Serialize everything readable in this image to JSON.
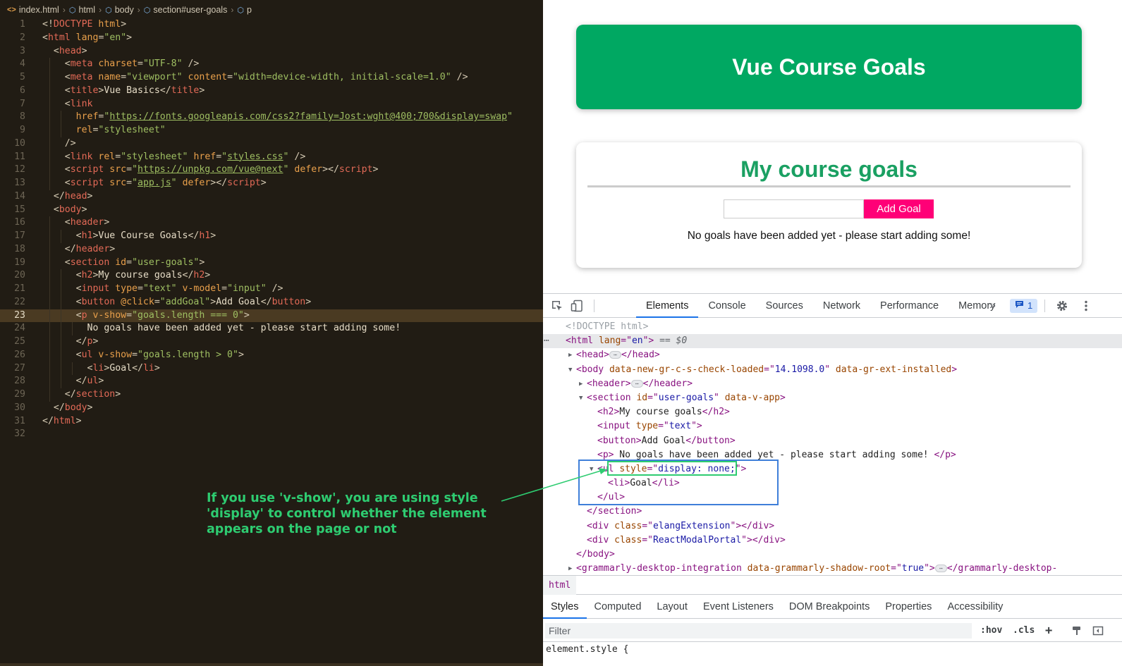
{
  "editor": {
    "breadcrumb": [
      "index.html",
      "html",
      "body",
      "section#user-goals",
      "p"
    ],
    "lines": [
      [
        [
          "pn",
          "<!"
        ],
        [
          "tag",
          "DOCTYPE"
        ],
        [
          "pn",
          " "
        ],
        [
          "attr",
          "html"
        ],
        [
          "pn",
          ">"
        ]
      ],
      [
        [
          "pn",
          "<"
        ],
        [
          "tag",
          "html"
        ],
        [
          "pn",
          " "
        ],
        [
          "attr",
          "lang"
        ],
        [
          "pn",
          "="
        ],
        [
          "str",
          "\"en\""
        ],
        [
          "pn",
          ">"
        ]
      ],
      [
        [
          "pn",
          "  <"
        ],
        [
          "tag",
          "head"
        ],
        [
          "pn",
          ">"
        ]
      ],
      [
        [
          "pn",
          "    <"
        ],
        [
          "tag",
          "meta"
        ],
        [
          "pn",
          " "
        ],
        [
          "attr",
          "charset"
        ],
        [
          "pn",
          "="
        ],
        [
          "str",
          "\"UTF-8\""
        ],
        [
          "pn",
          " />"
        ]
      ],
      [
        [
          "pn",
          "    <"
        ],
        [
          "tag",
          "meta"
        ],
        [
          "pn",
          " "
        ],
        [
          "attr",
          "name"
        ],
        [
          "pn",
          "="
        ],
        [
          "str",
          "\"viewport\""
        ],
        [
          "pn",
          " "
        ],
        [
          "attr",
          "content"
        ],
        [
          "pn",
          "="
        ],
        [
          "str",
          "\"width=device-width, initial-scale=1.0\""
        ],
        [
          "pn",
          " />"
        ]
      ],
      [
        [
          "pn",
          "    <"
        ],
        [
          "tag",
          "title"
        ],
        [
          "pn",
          ">"
        ],
        [
          "txt",
          "Vue Basics"
        ],
        [
          "pn",
          "</"
        ],
        [
          "tag",
          "title"
        ],
        [
          "pn",
          ">"
        ]
      ],
      [
        [
          "pn",
          "    <"
        ],
        [
          "tag",
          "link"
        ]
      ],
      [
        [
          "pn",
          "      "
        ],
        [
          "attr",
          "href"
        ],
        [
          "pn",
          "="
        ],
        [
          "str",
          "\""
        ],
        [
          "url",
          "https://fonts.googleapis.com/css2?family=Jost:wght@400;700&display=swap"
        ],
        [
          "str",
          "\""
        ]
      ],
      [
        [
          "pn",
          "      "
        ],
        [
          "attr",
          "rel"
        ],
        [
          "pn",
          "="
        ],
        [
          "str",
          "\"stylesheet\""
        ]
      ],
      [
        [
          "pn",
          "    />"
        ]
      ],
      [
        [
          "pn",
          "    <"
        ],
        [
          "tag",
          "link"
        ],
        [
          "pn",
          " "
        ],
        [
          "attr",
          "rel"
        ],
        [
          "pn",
          "="
        ],
        [
          "str",
          "\"stylesheet\""
        ],
        [
          "pn",
          " "
        ],
        [
          "attr",
          "href"
        ],
        [
          "pn",
          "="
        ],
        [
          "str",
          "\""
        ],
        [
          "url",
          "styles.css"
        ],
        [
          "str",
          "\""
        ],
        [
          "pn",
          " />"
        ]
      ],
      [
        [
          "pn",
          "    <"
        ],
        [
          "tag",
          "script"
        ],
        [
          "pn",
          " "
        ],
        [
          "attr",
          "src"
        ],
        [
          "pn",
          "="
        ],
        [
          "str",
          "\""
        ],
        [
          "url",
          "https://unpkg.com/vue@next"
        ],
        [
          "str",
          "\""
        ],
        [
          "pn",
          " "
        ],
        [
          "attr",
          "defer"
        ],
        [
          "pn",
          "></"
        ],
        [
          "tag",
          "script"
        ],
        [
          "pn",
          ">"
        ]
      ],
      [
        [
          "pn",
          "    <"
        ],
        [
          "tag",
          "script"
        ],
        [
          "pn",
          " "
        ],
        [
          "attr",
          "src"
        ],
        [
          "pn",
          "="
        ],
        [
          "str",
          "\""
        ],
        [
          "url",
          "app.js"
        ],
        [
          "str",
          "\""
        ],
        [
          "pn",
          " "
        ],
        [
          "attr",
          "defer"
        ],
        [
          "pn",
          "></"
        ],
        [
          "tag",
          "script"
        ],
        [
          "pn",
          ">"
        ]
      ],
      [
        [
          "pn",
          "  </"
        ],
        [
          "tag",
          "head"
        ],
        [
          "pn",
          ">"
        ]
      ],
      [
        [
          "pn",
          "  <"
        ],
        [
          "tag",
          "body"
        ],
        [
          "pn",
          ">"
        ]
      ],
      [
        [
          "pn",
          "    <"
        ],
        [
          "tag",
          "header"
        ],
        [
          "pn",
          ">"
        ]
      ],
      [
        [
          "pn",
          "      <"
        ],
        [
          "tag",
          "h1"
        ],
        [
          "pn",
          ">"
        ],
        [
          "txt",
          "Vue Course Goals"
        ],
        [
          "pn",
          "</"
        ],
        [
          "tag",
          "h1"
        ],
        [
          "pn",
          ">"
        ]
      ],
      [
        [
          "pn",
          "    </"
        ],
        [
          "tag",
          "header"
        ],
        [
          "pn",
          ">"
        ]
      ],
      [
        [
          "pn",
          "    <"
        ],
        [
          "tag",
          "section"
        ],
        [
          "pn",
          " "
        ],
        [
          "attr",
          "id"
        ],
        [
          "pn",
          "="
        ],
        [
          "str",
          "\"user-goals\""
        ],
        [
          "pn",
          ">"
        ]
      ],
      [
        [
          "pn",
          "      <"
        ],
        [
          "tag",
          "h2"
        ],
        [
          "pn",
          ">"
        ],
        [
          "txt",
          "My course goals"
        ],
        [
          "pn",
          "</"
        ],
        [
          "tag",
          "h2"
        ],
        [
          "pn",
          ">"
        ]
      ],
      [
        [
          "pn",
          "      <"
        ],
        [
          "tag",
          "input"
        ],
        [
          "pn",
          " "
        ],
        [
          "attr",
          "type"
        ],
        [
          "pn",
          "="
        ],
        [
          "str",
          "\"text\""
        ],
        [
          "pn",
          " "
        ],
        [
          "dir",
          "v-model"
        ],
        [
          "pn",
          "="
        ],
        [
          "str",
          "\"input\""
        ],
        [
          "pn",
          " />"
        ]
      ],
      [
        [
          "pn",
          "      <"
        ],
        [
          "tag",
          "button"
        ],
        [
          "pn",
          " "
        ],
        [
          "dir",
          "@click"
        ],
        [
          "pn",
          "="
        ],
        [
          "str",
          "\"addGoal\""
        ],
        [
          "pn",
          ">"
        ],
        [
          "txt",
          "Add Goal"
        ],
        [
          "pn",
          "</"
        ],
        [
          "tag",
          "button"
        ],
        [
          "pn",
          ">"
        ]
      ],
      [
        [
          "pn",
          "      <"
        ],
        [
          "tag",
          "p"
        ],
        [
          "pn",
          " "
        ],
        [
          "dir",
          "v-show"
        ],
        [
          "pn",
          "="
        ],
        [
          "str",
          "\"goals.length === 0\""
        ],
        [
          "pn",
          ">"
        ]
      ],
      [
        [
          "txt",
          "        No goals have been added yet - please start adding some!"
        ]
      ],
      [
        [
          "pn",
          "      </"
        ],
        [
          "tag",
          "p"
        ],
        [
          "pn",
          ">"
        ]
      ],
      [
        [
          "pn",
          "      <"
        ],
        [
          "tag",
          "ul"
        ],
        [
          "pn",
          " "
        ],
        [
          "dir",
          "v-show"
        ],
        [
          "pn",
          "="
        ],
        [
          "str",
          "\"goals.length > 0\""
        ],
        [
          "pn",
          ">"
        ]
      ],
      [
        [
          "pn",
          "        <"
        ],
        [
          "tag",
          "li"
        ],
        [
          "pn",
          ">"
        ],
        [
          "txt",
          "Goal"
        ],
        [
          "pn",
          "</"
        ],
        [
          "tag",
          "li"
        ],
        [
          "pn",
          ">"
        ]
      ],
      [
        [
          "pn",
          "      </"
        ],
        [
          "tag",
          "ul"
        ],
        [
          "pn",
          ">"
        ]
      ],
      [
        [
          "pn",
          "    </"
        ],
        [
          "tag",
          "section"
        ],
        [
          "pn",
          ">"
        ]
      ],
      [
        [
          "pn",
          "  </"
        ],
        [
          "tag",
          "body"
        ],
        [
          "pn",
          ">"
        ]
      ],
      [
        [
          "pn",
          "</"
        ],
        [
          "tag",
          "html"
        ],
        [
          "pn",
          ">"
        ]
      ],
      []
    ],
    "active_line": 23
  },
  "annotation": "If you use 'v-show', you are using style 'display' to control whether the element appears on the page or not",
  "page": {
    "header_title": "Vue Course Goals",
    "section_title": "My course goals",
    "input_value": "",
    "add_button": "Add Goal",
    "empty_message": "No goals have been added yet - please start adding some!"
  },
  "devtools": {
    "tabs": [
      "Elements",
      "Console",
      "Sources",
      "Network",
      "Performance",
      "Memory"
    ],
    "active_tab": "Elements",
    "more": "»",
    "issues_count": "1",
    "dom": [
      [
        [
          "doc",
          "<!DOCTYPE html>"
        ]
      ],
      [
        [
          "tag",
          "<html "
        ],
        [
          "attr",
          "lang"
        ],
        [
          "tag",
          "=\""
        ],
        [
          "val",
          "en"
        ],
        [
          "tag",
          "\">"
        ],
        [
          "sel",
          " == $0"
        ]
      ],
      [
        [
          "tag",
          "<head>"
        ],
        [
          "ell",
          "⋯"
        ],
        [
          "tag",
          "</head>"
        ]
      ],
      [
        [
          "tag",
          "<body "
        ],
        [
          "attr",
          "data-new-gr-c-s-check-loaded"
        ],
        [
          "tag",
          "=\""
        ],
        [
          "val",
          "14.1098.0"
        ],
        [
          "tag",
          "\" "
        ],
        [
          "attr",
          "data-gr-ext-installed"
        ],
        [
          "tag",
          ">"
        ]
      ],
      [
        [
          "tag",
          "<header>"
        ],
        [
          "ell",
          "⋯"
        ],
        [
          "tag",
          "</header>"
        ]
      ],
      [
        [
          "tag",
          "<section "
        ],
        [
          "attr",
          "id"
        ],
        [
          "tag",
          "=\""
        ],
        [
          "val",
          "user-goals"
        ],
        [
          "tag",
          "\" "
        ],
        [
          "attr",
          "data-v-app"
        ],
        [
          "tag",
          ">"
        ]
      ],
      [
        [
          "tag",
          "<h2>"
        ],
        [
          "txt",
          "My course goals"
        ],
        [
          "tag",
          "</h2>"
        ]
      ],
      [
        [
          "tag",
          "<input "
        ],
        [
          "attr",
          "type"
        ],
        [
          "tag",
          "=\""
        ],
        [
          "val",
          "text"
        ],
        [
          "tag",
          "\">"
        ]
      ],
      [
        [
          "tag",
          "<button>"
        ],
        [
          "txt",
          "Add Goal"
        ],
        [
          "tag",
          "</button>"
        ]
      ],
      [
        [
          "tag",
          "<p>"
        ],
        [
          "txt",
          " No goals have been added yet - please start adding some! "
        ],
        [
          "tag",
          "</p>"
        ]
      ],
      [
        [
          "tag",
          "<ul "
        ],
        [
          "attr",
          "style"
        ],
        [
          "tag",
          "=\""
        ],
        [
          "val",
          "display: none;"
        ],
        [
          "tag",
          "\">"
        ]
      ],
      [
        [
          "tag",
          "<li>"
        ],
        [
          "txt",
          "Goal"
        ],
        [
          "tag",
          "</li>"
        ]
      ],
      [
        [
          "tag",
          "</ul>"
        ]
      ],
      [
        [
          "tag",
          "</section>"
        ]
      ],
      [
        [
          "tag",
          "<div "
        ],
        [
          "attr",
          "class"
        ],
        [
          "tag",
          "=\""
        ],
        [
          "val",
          "elangExtension"
        ],
        [
          "tag",
          "\"></div>"
        ]
      ],
      [
        [
          "tag",
          "<div "
        ],
        [
          "attr",
          "class"
        ],
        [
          "tag",
          "=\""
        ],
        [
          "val",
          "ReactModalPortal"
        ],
        [
          "tag",
          "\"></div>"
        ]
      ],
      [
        [
          "tag",
          "</body>"
        ]
      ],
      [
        [
          "tag",
          "<grammarly-desktop-integration "
        ],
        [
          "attr",
          "data-grammarly-shadow-root"
        ],
        [
          "tag",
          "=\""
        ],
        [
          "val",
          "true"
        ],
        [
          "tag",
          "\">"
        ],
        [
          "ell",
          "⋯"
        ],
        [
          "tag",
          "</grammarly-desktop-"
        ]
      ]
    ],
    "crumb": "html",
    "style_tabs": [
      "Styles",
      "Computed",
      "Layout",
      "Event Listeners",
      "DOM Breakpoints",
      "Properties",
      "Accessibility"
    ],
    "active_style_tab": "Styles",
    "filter_placeholder": "Filter",
    "hov": ":hov",
    "cls": ".cls",
    "element_style": "element.style {"
  }
}
